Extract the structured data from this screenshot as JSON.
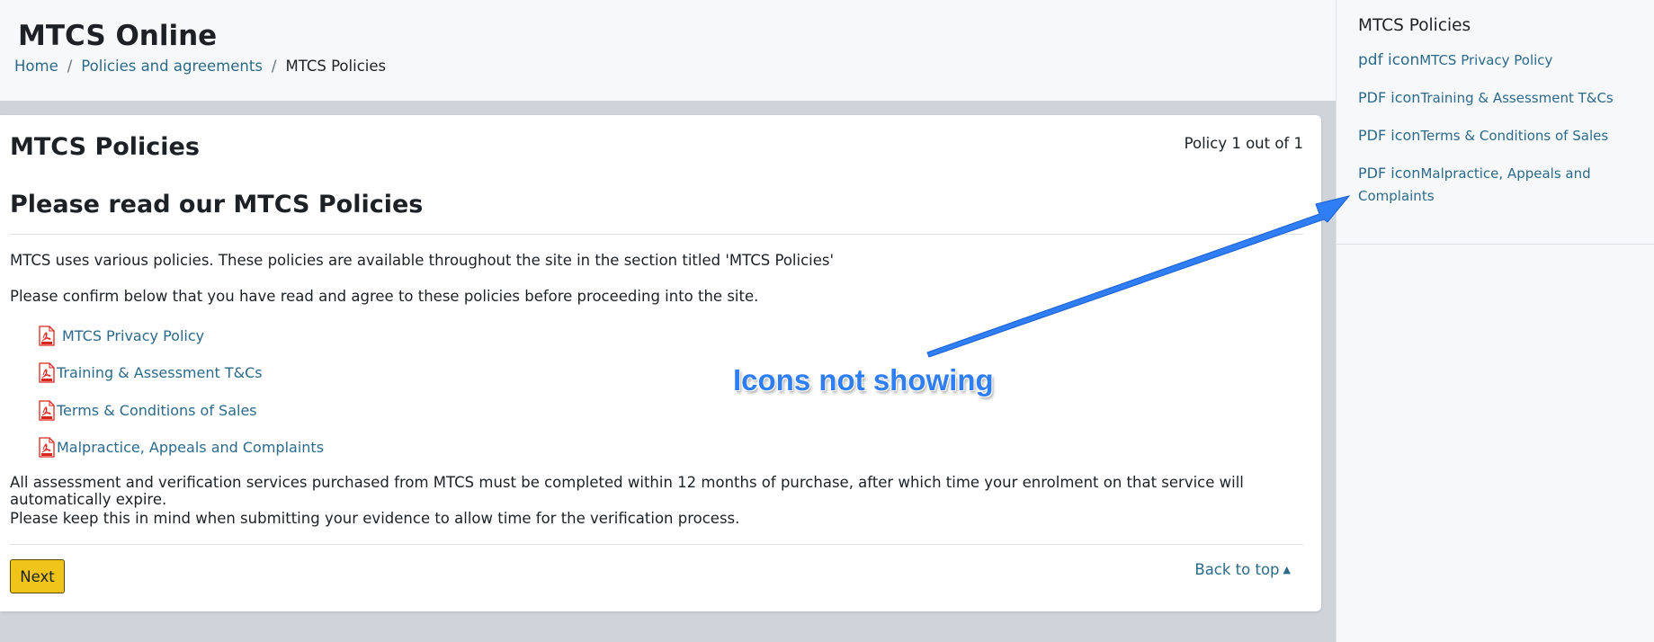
{
  "header": {
    "site_title": "MTCS Online",
    "breadcrumb": [
      {
        "label": "Home"
      },
      {
        "label": "Policies and agreements"
      },
      {
        "label": "MTCS Policies"
      }
    ],
    "separator": "/"
  },
  "main": {
    "title": "MTCS Policies",
    "policy_count": "Policy 1 out of 1",
    "subheading": "Please read our MTCS Policies",
    "intro_1": "MTCS uses various policies. These policies are available throughout the site in the section titled 'MTCS Policies'",
    "intro_2": "Please confirm below that you have read and agree to these policies before proceeding into the site.",
    "policies": [
      {
        "label": "MTCS Privacy Policy",
        "icon": "pdf-icon"
      },
      {
        "label": "Training & Assessment T&Cs",
        "icon": "pdf-icon"
      },
      {
        "label": "Terms & Conditions of Sales",
        "icon": "pdf-icon"
      },
      {
        "label": "Malpractice, Appeals and Complaints",
        "icon": "pdf-icon"
      }
    ],
    "notice_1": "All assessment and verification services purchased from MTCS must be completed within 12 months of purchase, after which time your enrolment on that service will automatically expire.",
    "notice_2": "Please keep this in mind when submitting your evidence to allow time for the verification process.",
    "next_label": "Next",
    "back_to_top_label": "Back to top",
    "back_to_top_icon": "caret-up-icon"
  },
  "drawer": {
    "title": "MTCS Policies",
    "links": [
      {
        "alt": "pdf icon",
        "label": "MTCS Privacy Policy"
      },
      {
        "alt": "PDF icon",
        "label": "Training & Assessment T&Cs"
      },
      {
        "alt": "PDF icon",
        "label": "Terms & Conditions of Sales"
      },
      {
        "alt": "PDF icon",
        "label": "Malpractice, Appeals and Complaints"
      }
    ]
  },
  "annotation": {
    "text": "Icons not showing",
    "color": "#2f7ef5"
  },
  "colors": {
    "link": "#2b6a8a",
    "button_bg": "#f0c419",
    "page_bg": "#ced4da",
    "pdf_red": "#d9261c"
  }
}
